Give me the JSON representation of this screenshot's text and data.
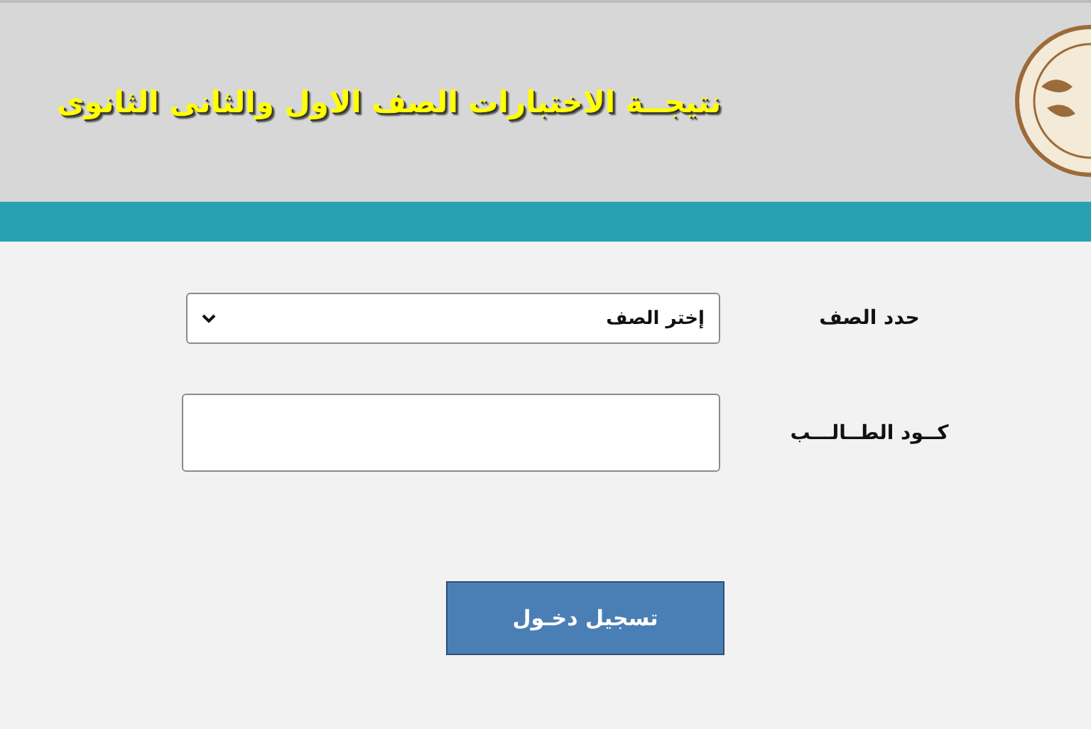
{
  "header": {
    "title": "نتيجــة  الاختبارات الصف الاول والثانى الثانوى"
  },
  "form": {
    "fields": [
      {
        "kind": "select",
        "label": "حدد الصف",
        "value": "إختر الصف"
      },
      {
        "kind": "text",
        "label": "كــود الطــالـــب"
      }
    ],
    "submit": "تسجيل دخـول"
  }
}
